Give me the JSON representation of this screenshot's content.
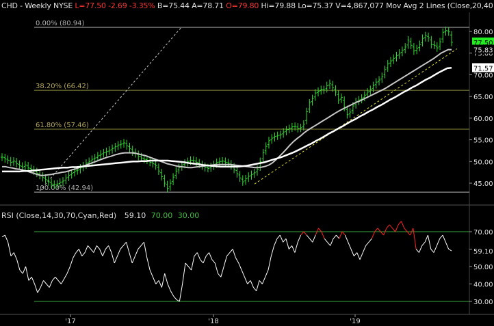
{
  "colors": {
    "background": "#000000",
    "text": "#e0e0e0",
    "price_up": "#33dd33",
    "price_down": "#33dd33",
    "change_negative": "#ff3333",
    "ma20": "#c8c8c8",
    "ma40": "#ffffff",
    "fib_line": "#8c8c3c",
    "fib_text": "#b4a85a",
    "rsi_line": "#ffffff",
    "rsi_hi": "#ff2222",
    "rsi_bounds": "#3aa83a",
    "rsi_70_text": "#40c040",
    "grid_axis": "#888888",
    "last_price_bg": "#22ee22"
  },
  "header": {
    "symbol": "CHD",
    "interval": "- Weekly",
    "exchange": "NYSE",
    "last": "L=77.50",
    "change": "-2.69",
    "change_pct": "-3.35%",
    "bid": "B=75.44",
    "ask": "A=78.71",
    "open": "O=79.80",
    "high": "Hi=79.88",
    "low": "Lo=75.37",
    "volume": "V=4,867,077",
    "study": "Mov Avg 2 Lines (Close,20,40"
  },
  "rsi_header": {
    "label": "RSI (Close,14,30,70,Cyan,Red)",
    "value": "59.10",
    "upper": "70.00",
    "lower": "30.00"
  },
  "price_axis": {
    "ticks": [
      "80.00",
      "75.00",
      "70.00",
      "65.00",
      "60.00",
      "55.00",
      "50.00",
      "45.00"
    ],
    "last_price_label": "77.50",
    "ma20_label": "75.83",
    "ma40_label": "71.57"
  },
  "rsi_axis": {
    "ticks": [
      "70.00",
      "60.00",
      "50.00",
      "40.00",
      "30.00"
    ],
    "value_label": "59.10"
  },
  "x_axis": {
    "labels": [
      "'17",
      "'18",
      "'19"
    ]
  },
  "fib_labels": {
    "f0": "0.00% (80.94)",
    "f382": "38.20% (66.42)",
    "f618": "61.80% (57.46)",
    "f100": "100.00% (42.94)"
  },
  "chart_data": [
    {
      "type": "line",
      "title": "CHD - Weekly NYSE",
      "x_labels": [
        "'17",
        "'18",
        "'19"
      ],
      "ylim": [
        42.5,
        82.5
      ],
      "y_axis_position": "right",
      "fib_levels": [
        {
          "name": "0.00%",
          "value": 80.94
        },
        {
          "name": "38.20%",
          "value": 66.42
        },
        {
          "name": "61.80%",
          "value": 57.46
        },
        {
          "name": "100.00%",
          "value": 42.94
        }
      ],
      "price_close": [
        51.0,
        50.6,
        50.3,
        49.8,
        50.1,
        49.5,
        49.0,
        48.7,
        49.2,
        48.5,
        48.2,
        47.8,
        47.3,
        46.8,
        46.3,
        45.8,
        45.3,
        44.8,
        44.6,
        44.8,
        45.2,
        45.5,
        46.2,
        46.8,
        47.3,
        47.8,
        48.0,
        48.5,
        49.0,
        49.6,
        50.0,
        50.5,
        50.8,
        51.3,
        51.7,
        52.0,
        52.3,
        52.6,
        53.0,
        53.4,
        53.8,
        54.0,
        54.3,
        53.6,
        53.0,
        52.2,
        51.8,
        51.2,
        50.8,
        50.5,
        50.3,
        49.8,
        49.5,
        49.0,
        47.8,
        46.5,
        45.0,
        43.8,
        45.0,
        46.4,
        47.8,
        48.6,
        49.2,
        49.6,
        50.0,
        50.3,
        50.2,
        49.8,
        49.4,
        49.0,
        48.6,
        48.4,
        48.8,
        49.3,
        49.8,
        50.0,
        50.1,
        49.8,
        49.6,
        49.0,
        48.2,
        47.2,
        46.2,
        45.3,
        46.0,
        46.6,
        47.0,
        47.4,
        48.2,
        50.0,
        52.0,
        53.5,
        54.8,
        55.4,
        55.8,
        56.0,
        56.2,
        56.8,
        57.3,
        57.6,
        58.0,
        58.1,
        57.6,
        57.8,
        58.6,
        61.5,
        63.5,
        64.5,
        65.8,
        66.2,
        66.6,
        66.5,
        67.5,
        68.0,
        67.0,
        66.0,
        64.2,
        64.8,
        62.5,
        60.8,
        61.4,
        62.8,
        63.8,
        64.2,
        64.6,
        65.3,
        66.0,
        66.6,
        67.5,
        68.3,
        68.8,
        69.6,
        71.2,
        72.5,
        73.2,
        73.8,
        74.4,
        75.0,
        75.6,
        76.4,
        78.0,
        76.8,
        75.5,
        76.0,
        77.0,
        78.4,
        79.0,
        78.5,
        77.0,
        76.8,
        76.2,
        77.6,
        79.8,
        80.2,
        79.9,
        77.5
      ],
      "series": [
        {
          "name": "Mov Avg 20",
          "values": [
            48.8,
            48.8,
            48.6,
            48.5,
            48.3,
            48.2,
            48.0,
            47.8,
            47.5,
            47.3,
            47.0,
            46.8,
            46.8,
            46.9,
            47.0,
            47.2,
            47.3,
            47.5,
            47.6,
            47.8,
            48.1,
            48.3,
            48.6,
            48.9,
            49.2,
            49.5,
            49.8,
            50.1,
            50.4,
            50.7,
            51.0,
            51.2,
            51.5,
            51.7,
            51.9,
            52.0,
            52.0,
            52.0,
            51.9,
            51.7,
            51.5,
            51.3,
            51.0,
            50.7,
            50.4,
            50.1,
            49.8,
            49.5,
            49.3,
            49.1,
            48.9,
            48.8,
            48.7,
            48.6,
            48.6,
            48.7,
            48.8,
            48.9,
            49.0,
            49.1,
            49.2,
            49.3,
            49.3,
            49.3,
            49.3,
            49.3,
            49.2,
            49.1,
            49.0,
            48.9,
            48.8,
            48.7,
            48.6,
            48.6,
            48.7,
            48.9,
            49.2,
            49.7,
            50.4,
            51.2,
            52.0,
            52.9,
            53.8,
            54.6,
            55.3,
            55.9,
            56.6,
            57.2,
            57.7,
            58.2,
            58.7,
            59.2,
            59.7,
            60.2,
            60.7,
            61.2,
            61.7,
            62.1,
            62.5,
            62.9,
            63.3,
            63.7,
            64.0,
            64.4,
            64.8,
            65.2,
            65.6,
            66.0,
            66.4,
            66.8,
            67.3,
            67.8,
            68.3,
            68.8,
            69.3,
            69.8,
            70.3,
            70.8,
            71.3,
            71.8,
            72.3,
            72.8,
            73.3,
            73.8,
            74.4,
            75.0,
            75.4,
            75.8,
            75.8
          ]
        },
        {
          "name": "Mov Avg 40",
          "values": [
            47.7,
            47.7,
            47.7,
            47.7,
            47.7,
            47.8,
            47.8,
            47.9,
            48.0,
            48.1,
            48.2,
            48.3,
            48.4,
            48.5,
            48.6,
            48.6,
            48.7,
            48.7,
            48.8,
            48.9,
            49.0,
            49.1,
            49.2,
            49.3,
            49.4,
            49.5,
            49.6,
            49.7,
            49.8,
            49.9,
            50.0,
            50.0,
            50.1,
            50.1,
            50.2,
            50.2,
            50.2,
            50.2,
            50.2,
            50.1,
            50.0,
            49.9,
            49.8,
            49.6,
            49.5,
            49.4,
            49.2,
            49.1,
            49.0,
            48.9,
            48.8,
            48.8,
            48.8,
            48.8,
            48.8,
            48.9,
            49.0,
            49.2,
            49.4,
            49.6,
            49.8,
            50.1,
            50.4,
            50.7,
            51.0,
            51.4,
            51.8,
            52.2,
            52.7,
            53.2,
            53.7,
            54.2,
            54.8,
            55.3,
            55.9,
            56.5,
            57.0,
            57.6,
            58.1,
            58.7,
            59.3,
            59.8,
            60.4,
            60.9,
            61.5,
            62.0,
            62.6,
            63.1,
            63.7,
            64.3,
            64.8,
            65.4,
            66.0,
            66.5,
            67.1,
            67.6,
            68.2,
            68.8,
            69.3,
            69.9,
            70.5,
            71.0,
            71.5,
            71.6
          ]
        }
      ]
    },
    {
      "type": "line",
      "title": "RSI (Close,14,30,70,Cyan,Red)",
      "ylim": [
        25,
        75
      ],
      "upper_bound": 70,
      "lower_bound": 30,
      "series": [
        {
          "name": "RSI",
          "values": [
            67,
            68,
            64,
            56,
            58,
            54,
            48,
            46,
            50,
            42,
            44,
            40,
            35,
            38,
            42,
            40,
            38,
            42,
            44,
            42,
            40,
            43,
            46,
            50,
            55,
            58,
            60,
            56,
            58,
            62,
            60,
            58,
            62,
            60,
            56,
            60,
            62,
            58,
            52,
            56,
            60,
            62,
            64,
            58,
            52,
            56,
            60,
            62,
            64,
            55,
            48,
            44,
            40,
            42,
            38,
            46,
            40,
            36,
            33,
            31,
            30,
            40,
            52,
            50,
            48,
            56,
            58,
            54,
            52,
            56,
            58,
            54,
            52,
            46,
            44,
            50,
            56,
            58,
            60,
            55,
            52,
            48,
            44,
            40,
            42,
            38,
            36,
            42,
            40,
            44,
            48,
            56,
            62,
            66,
            68,
            64,
            66,
            60,
            62,
            58,
            64,
            68,
            70,
            68,
            66,
            64,
            68,
            72,
            70,
            66,
            64,
            62,
            66,
            68,
            66,
            70,
            68,
            64,
            60,
            56,
            58,
            54,
            58,
            62,
            64,
            66,
            70,
            72,
            70,
            68,
            72,
            74,
            72,
            70,
            74,
            76,
            72,
            70,
            68,
            72,
            60,
            58,
            62,
            64,
            68,
            60,
            58,
            62,
            66,
            68,
            64,
            60,
            59
          ]
        }
      ]
    }
  ]
}
